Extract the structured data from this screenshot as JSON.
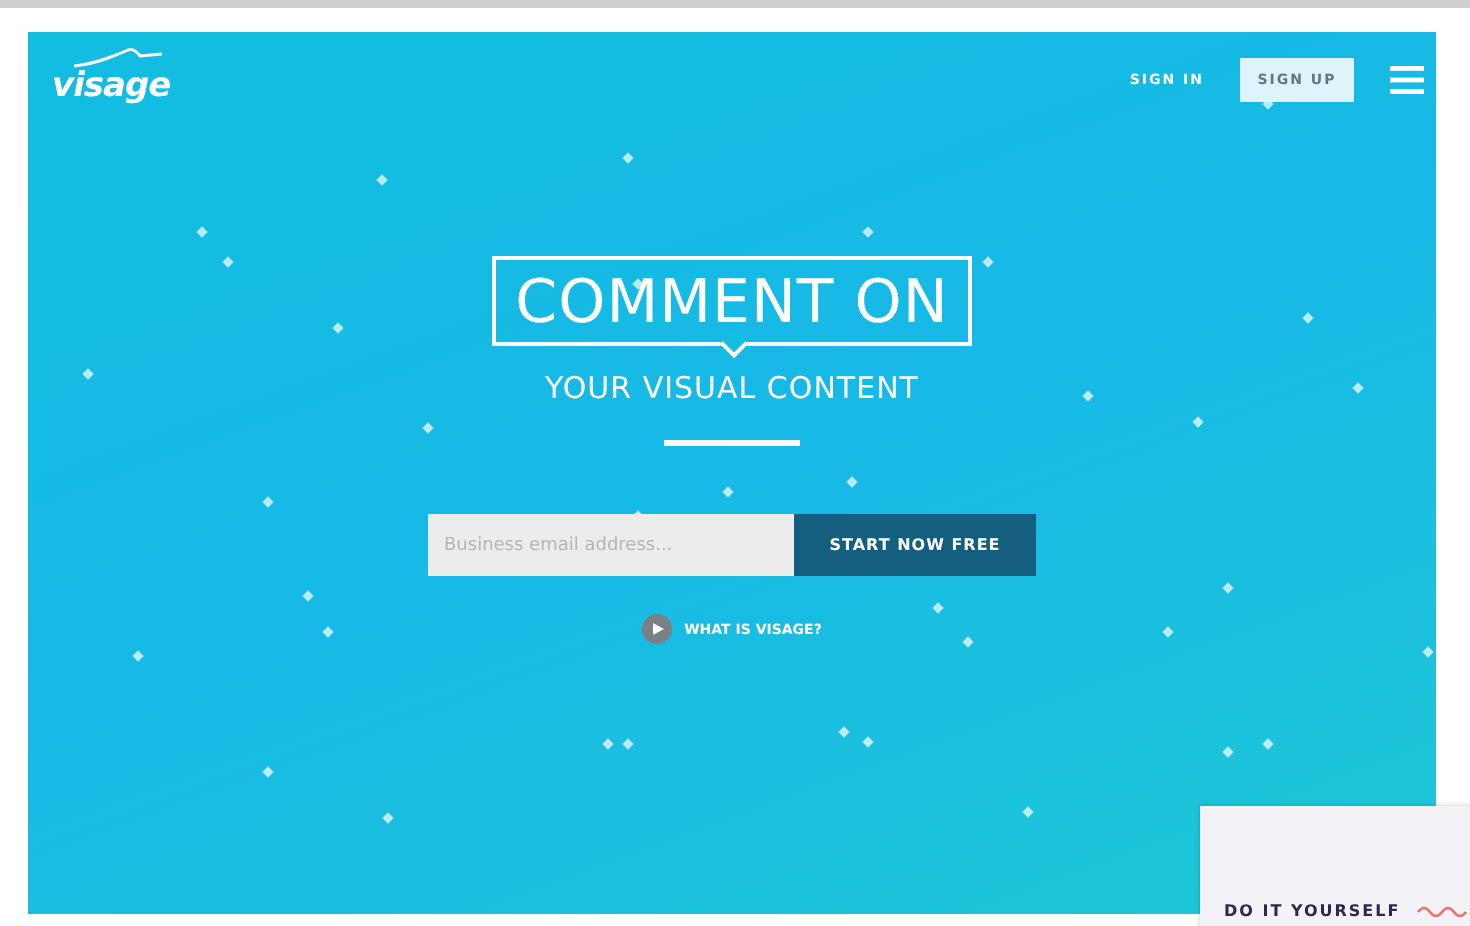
{
  "nav": {
    "logo": "visage",
    "sign_in": "SIGN IN",
    "sign_up": "SIGN UP"
  },
  "hero": {
    "headline": "COMMENT ON",
    "subheadline": "YOUR VISUAL CONTENT"
  },
  "signup_form": {
    "placeholder": "Business email address...",
    "button": "START NOW FREE"
  },
  "video_link": "WHAT IS VISAGE?",
  "card": {
    "title": "DO IT YOURSELF"
  }
}
